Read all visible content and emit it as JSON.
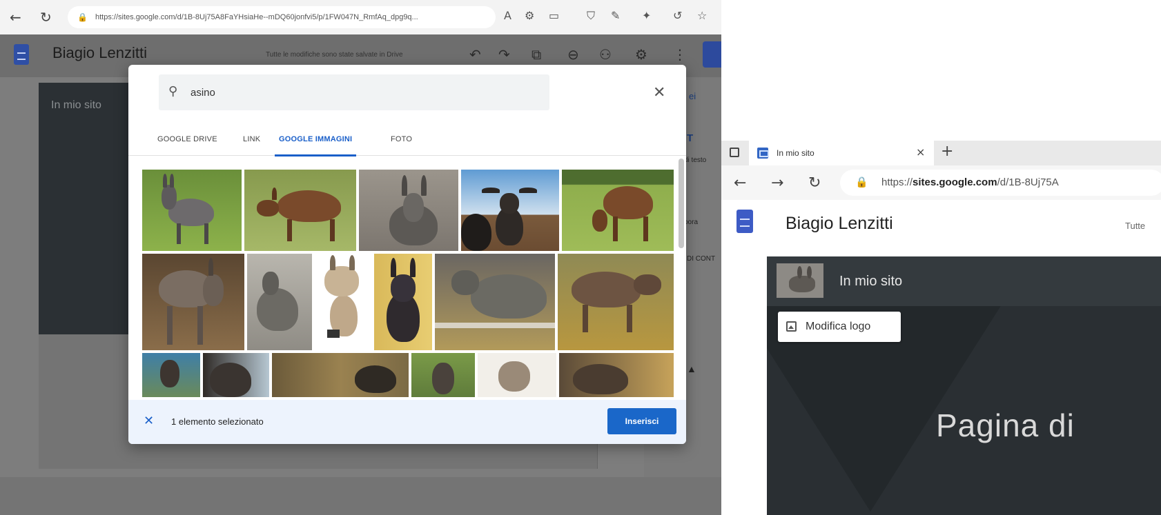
{
  "left": {
    "browser": {
      "url": "https://sites.google.com/d/1B-8Uj75A8FaYHsiaHe--mDQ60jonfvi5/p/1FW047N_RmfAq_dpg9q..."
    },
    "app": {
      "site_title": "Biagio  Lenzitti",
      "save_status": "Tutte le modifiche sono state salvate in Drive"
    },
    "canvas": {
      "header_text": "In mio sito"
    },
    "right_panel": {
      "tab_short": "ei",
      "item1": "T",
      "item1_sub": "di testo",
      "item2_sub": "pora",
      "item3_sub": "DI CONT"
    },
    "dialog": {
      "search": {
        "value": "asino",
        "placeholder": ""
      },
      "tabs": [
        {
          "label": "GOOGLE DRIVE",
          "active": false
        },
        {
          "label": "LINK",
          "active": false
        },
        {
          "label": "GOOGLE IMMAGINI",
          "active": true
        },
        {
          "label": "FOTO",
          "active": false
        }
      ],
      "selection_count": "1 elemento selezionato",
      "insert_label": "Inserisci",
      "images_count_visible": 17,
      "selected_image_index": 2
    }
  },
  "right": {
    "tab": {
      "title": "In mio sito"
    },
    "browser": {
      "url_bold": "sites.google.com",
      "url_prefix": "https://",
      "url_rest": "/d/1B-8Uj75A"
    },
    "app": {
      "site_title": "Biagio  Lenzitti",
      "save_status_partial": "Tutte"
    },
    "site": {
      "header_name": "In mio sito",
      "edit_logo_label": "Modifica logo",
      "page_title_partial": "Pagina di"
    }
  },
  "colors": {
    "accent_blue": "#1a67c9",
    "dark_theme": "#2a2f33",
    "footer_bg": "#edf3fd"
  },
  "icons": [
    "back-arrow-icon",
    "refresh-icon",
    "lock-icon",
    "undo-icon",
    "redo-icon",
    "preview-icon",
    "link-icon",
    "share-icon",
    "settings-icon",
    "more-icon",
    "search-icon",
    "close-icon",
    "image-icon"
  ]
}
